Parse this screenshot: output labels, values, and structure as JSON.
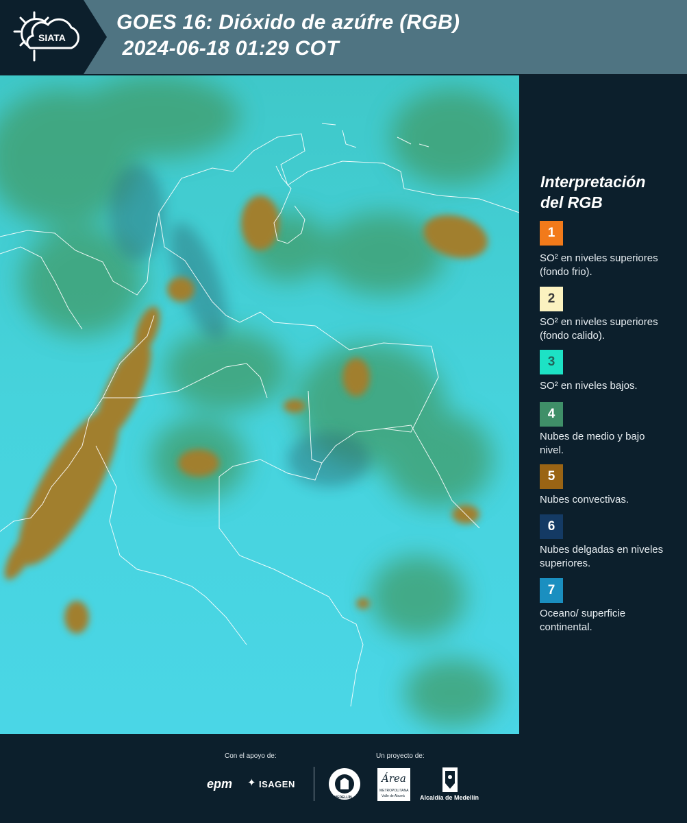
{
  "header": {
    "logo_text": "SIATA",
    "title_line1": "GOES 16: Dióxido de azúfre (RGB)",
    "title_line2": " 2024-06-18 01:29 COT"
  },
  "legend": {
    "title_line1": "Interpretación",
    "title_line2": "del RGB",
    "items": [
      {
        "number": "1",
        "color": "#f27a1a",
        "text_color": "#ffffff",
        "label": "SO² en niveles superiores (fondo frio)."
      },
      {
        "number": "2",
        "color": "#fbf2c0",
        "text_color": "#3a3a3a",
        "label": "SO² en niveles superiores (fondo calido)."
      },
      {
        "number": "3",
        "color": "#1de2c5",
        "text_color": "#22645a",
        "label": "SO² en niveles bajos."
      },
      {
        "number": "4",
        "color": "#3f8f68",
        "text_color": "#ffffff",
        "label": "Nubes de medio y bajo nivel."
      },
      {
        "number": "5",
        "color": "#9a6414",
        "text_color": "#ffffff",
        "label": "Nubes convectivas."
      },
      {
        "number": "6",
        "color": "#143a64",
        "text_color": "#ffffff",
        "label": "Nubes delgadas en niveles superiores."
      },
      {
        "number": "7",
        "color": "#1a8fc0",
        "text_color": "#ffffff",
        "label": "Oceano/ superficie continental."
      }
    ]
  },
  "footer": {
    "support_label": "Con el apoyo de:",
    "project_label": "Un proyecto de:",
    "sponsor1": "epm",
    "sponsor2": "ISAGEN",
    "partner_area": "Área",
    "partner_area_sub": "METROPOLITANA",
    "partner_area_sub2": "Valle de Aburrá",
    "partner_medellin_ring": "MEDELLÍN",
    "partner_alcaldia": "Alcaldía de Medellín"
  }
}
